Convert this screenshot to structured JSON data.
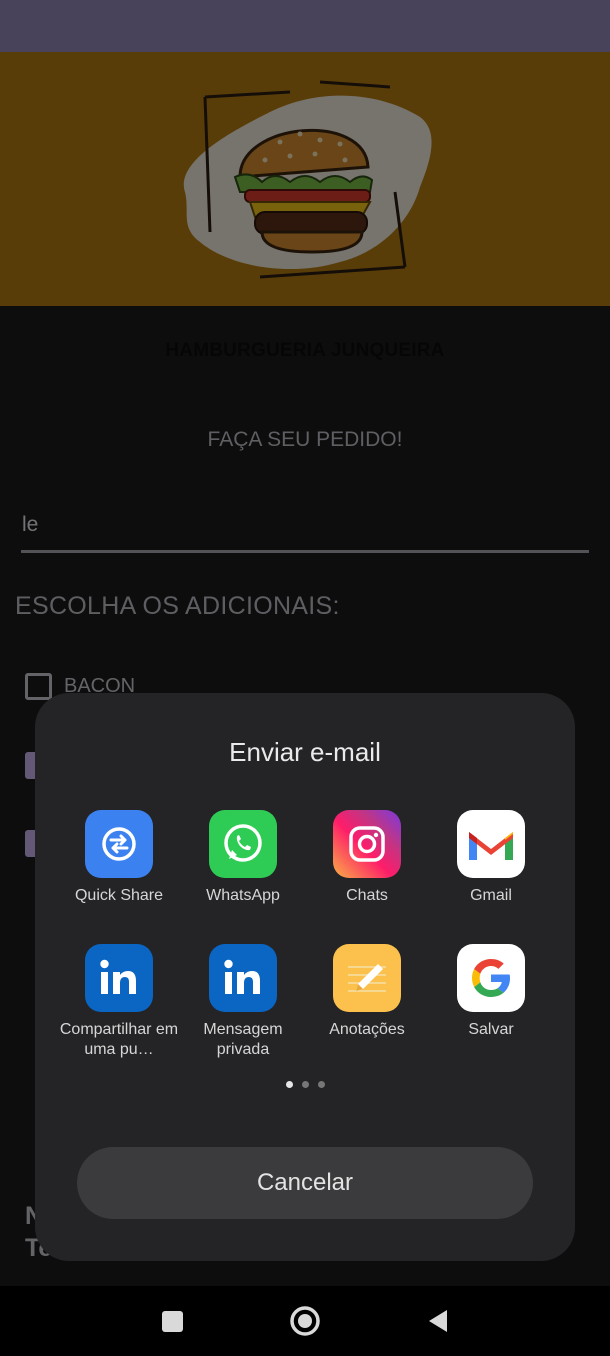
{
  "app": {
    "title": "HAMBURGUERIA JUNQUEIRA",
    "order_heading": "FAÇA SEU PEDIDO!",
    "name_input_value": "le",
    "addons_heading": "ESCOLHA OS ADICIONAIS:",
    "addons": [
      {
        "label": "BACON",
        "checked": false
      },
      {
        "label": "",
        "checked": true
      },
      {
        "label": "",
        "checked": true
      }
    ],
    "bottom_text_line1": "N",
    "bottom_text_line2": "Te"
  },
  "share_sheet": {
    "title": "Enviar e-mail",
    "apps": [
      {
        "label": "Quick Share",
        "icon": "quick-share-icon"
      },
      {
        "label": "WhatsApp",
        "icon": "whatsapp-icon"
      },
      {
        "label": "Chats",
        "icon": "instagram-icon"
      },
      {
        "label": "Gmail",
        "icon": "gmail-icon"
      },
      {
        "label": "Compartilhar em uma pu…",
        "icon": "linkedin-icon"
      },
      {
        "label": "Mensagem privada",
        "icon": "linkedin-icon"
      },
      {
        "label": "Anotações",
        "icon": "notes-icon"
      },
      {
        "label": "Salvar",
        "icon": "google-icon"
      }
    ],
    "pages": 3,
    "active_page": 1,
    "cancel_label": "Cancelar"
  },
  "nav": {
    "buttons": [
      "recent-apps-icon",
      "home-icon",
      "back-icon"
    ]
  },
  "colors": {
    "status_bar": "#9384b6",
    "banner": "#b37b12",
    "background": "#1b1b1d",
    "sheet": "#242426",
    "checkbox_checked": "#c7b2ee"
  }
}
